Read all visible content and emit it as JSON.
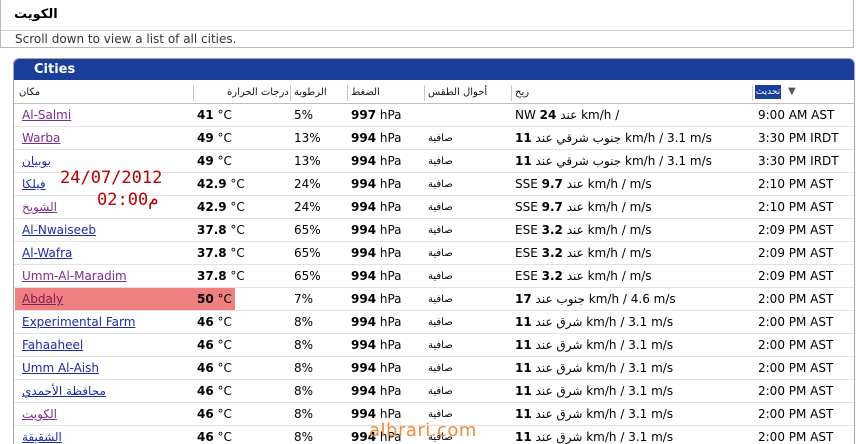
{
  "page": {
    "title": "الكويت",
    "subtitle": "Scroll down to view a list of all cities."
  },
  "panel": {
    "title": "Cities"
  },
  "columns": {
    "city": "مكان",
    "temp": "درجات الحرارة",
    "humidity": "الرطوبة",
    "pressure": "الضغط",
    "conditions": "أحوال الطقس",
    "wind": "ريح",
    "time": "تحديث"
  },
  "overlay": {
    "date": "24/07/2012",
    "time": "02:00م"
  },
  "watermark": "albrari.com",
  "colors": {
    "header_bg": "#1a3e9c",
    "highlight": "#f07f7f",
    "link": "#1f2aa8",
    "visited": "#7c2d8e",
    "overlay_text": "#b80000",
    "watermark": "#f08a3a"
  },
  "rows": [
    {
      "city": "Al-Salmi",
      "visited": true,
      "temp_val": "41",
      "temp_unit": " °C",
      "hum": "5%",
      "pres_val": "997",
      "pres_unit": " hPa",
      "cond": "",
      "wind_pre": "NW ",
      "wind_speed": "24",
      "wind_post": " عند km/h / ",
      "time": "9:00 AM AST"
    },
    {
      "city": "Warba",
      "visited": true,
      "temp_val": "49",
      "temp_unit": " °C",
      "hum": "13%",
      "pres_val": "994",
      "pres_unit": " hPa",
      "cond": "صافية",
      "wind_pre": "",
      "wind_speed": "11",
      "wind_post": " جنوب شرقي عند km/h / 3.1 m/s",
      "time": "3:30 PM IRDT"
    },
    {
      "city": "بوبيان",
      "visited": false,
      "temp_val": "49",
      "temp_unit": " °C",
      "hum": "13%",
      "pres_val": "994",
      "pres_unit": " hPa",
      "cond": "صافية",
      "wind_pre": "",
      "wind_speed": "11",
      "wind_post": " جنوب شرقي عند km/h / 3.1 m/s",
      "time": "3:30 PM IRDT"
    },
    {
      "city": "فيلكا",
      "visited": false,
      "temp_val": "42.9",
      "temp_unit": " °C",
      "hum": "24%",
      "pres_val": "994",
      "pres_unit": " hPa",
      "cond": "صافية",
      "wind_pre": "SSE ",
      "wind_speed": "9.7",
      "wind_post": " عند km/h /  m/s",
      "time": "2:10 PM AST"
    },
    {
      "city": "الشويخ",
      "visited": true,
      "temp_val": "42.9",
      "temp_unit": " °C",
      "hum": "24%",
      "pres_val": "994",
      "pres_unit": " hPa",
      "cond": "صافية",
      "wind_pre": "SSE ",
      "wind_speed": "9.7",
      "wind_post": " عند km/h /  m/s",
      "time": "2:10 PM AST"
    },
    {
      "city": "Al-Nwaiseeb",
      "visited": false,
      "temp_val": "37.8",
      "temp_unit": " °C",
      "hum": "65%",
      "pres_val": "994",
      "pres_unit": " hPa",
      "cond": "صافية",
      "wind_pre": "ESE ",
      "wind_speed": "3.2",
      "wind_post": " عند km/h /  m/s",
      "time": "2:09 PM AST"
    },
    {
      "city": "Al-Wafra",
      "visited": false,
      "temp_val": "37.8",
      "temp_unit": " °C",
      "hum": "65%",
      "pres_val": "994",
      "pres_unit": " hPa",
      "cond": "صافية",
      "wind_pre": "ESE ",
      "wind_speed": "3.2",
      "wind_post": " عند km/h /  m/s",
      "time": "2:09 PM AST"
    },
    {
      "city": "Umm-Al-Maradim",
      "visited": true,
      "temp_val": "37.8",
      "temp_unit": " °C",
      "hum": "65%",
      "pres_val": "994",
      "pres_unit": " hPa",
      "cond": "صافية",
      "wind_pre": "ESE ",
      "wind_speed": "3.2",
      "wind_post": " عند km/h /  m/s",
      "time": "2:09 PM AST"
    },
    {
      "city": "Abdaly",
      "visited": false,
      "highlight": true,
      "temp_val": "50",
      "temp_unit": " °C",
      "hum": "7%",
      "pres_val": "994",
      "pres_unit": " hPa",
      "cond": "صافية",
      "wind_pre": "",
      "wind_speed": "17",
      "wind_post": " جنوب عند km/h / 4.6 m/s",
      "time": "2:00 PM AST"
    },
    {
      "city": "Experimental Farm",
      "visited": false,
      "temp_val": "46",
      "temp_unit": " °C",
      "hum": "8%",
      "pres_val": "994",
      "pres_unit": " hPa",
      "cond": "صافية",
      "wind_pre": "",
      "wind_speed": "11",
      "wind_post": " شرق عند km/h / 3.1 m/s",
      "time": "2:00 PM AST"
    },
    {
      "city": "Fahaaheel",
      "visited": false,
      "temp_val": "46",
      "temp_unit": " °C",
      "hum": "8%",
      "pres_val": "994",
      "pres_unit": " hPa",
      "cond": "صافية",
      "wind_pre": "",
      "wind_speed": "11",
      "wind_post": " شرق عند km/h / 3.1 m/s",
      "time": "2:00 PM AST"
    },
    {
      "city": "Umm Al-Aish",
      "visited": false,
      "temp_val": "46",
      "temp_unit": " °C",
      "hum": "8%",
      "pres_val": "994",
      "pres_unit": " hPa",
      "cond": "صافية",
      "wind_pre": "",
      "wind_speed": "11",
      "wind_post": " شرق عند km/h / 3.1 m/s",
      "time": "2:00 PM AST"
    },
    {
      "city": "محافظة الأحمدي",
      "visited": false,
      "temp_val": "46",
      "temp_unit": " °C",
      "hum": "8%",
      "pres_val": "994",
      "pres_unit": " hPa",
      "cond": "صافية",
      "wind_pre": "",
      "wind_speed": "11",
      "wind_post": " شرق عند km/h / 3.1 m/s",
      "time": "2:00 PM AST"
    },
    {
      "city": "الكويت",
      "visited": true,
      "temp_val": "46",
      "temp_unit": " °C",
      "hum": "8%",
      "pres_val": "994",
      "pres_unit": " hPa",
      "cond": "صافية",
      "wind_pre": "",
      "wind_speed": "11",
      "wind_post": " شرق عند km/h / 3.1 m/s",
      "time": "2:00 PM AST"
    },
    {
      "city": "الشقيقة",
      "visited": false,
      "temp_val": "46",
      "temp_unit": " °C",
      "hum": "8%",
      "pres_val": "994",
      "pres_unit": " hPa",
      "cond": "صافية",
      "wind_pre": "",
      "wind_speed": "11",
      "wind_post": " شرق عند km/h / 3.1 m/s",
      "time": "2:00 PM AST"
    }
  ]
}
